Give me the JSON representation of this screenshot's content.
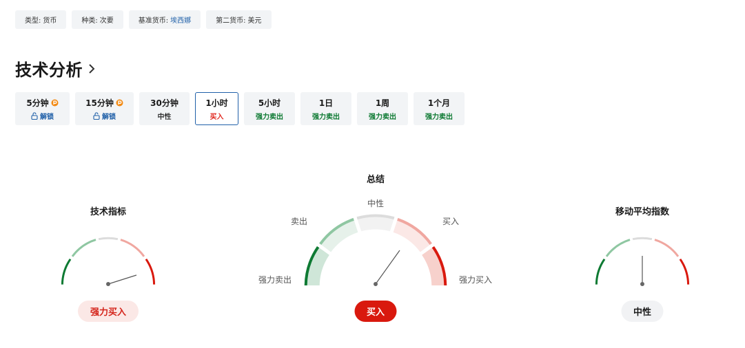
{
  "tags": [
    {
      "label": "类型:",
      "value": "货币",
      "link": false
    },
    {
      "label": "种类:",
      "value": "次要",
      "link": false
    },
    {
      "label": "基准货币:",
      "value": "埃西娜",
      "link": true
    },
    {
      "label": "第二货币:",
      "value": "美元",
      "link": false
    }
  ],
  "title": "技术分析",
  "periods": [
    {
      "label": "5分钟",
      "status": "解锁",
      "pro": true,
      "locked": true,
      "tone": "blue"
    },
    {
      "label": "15分钟",
      "status": "解锁",
      "pro": true,
      "locked": true,
      "tone": "blue"
    },
    {
      "label": "30分钟",
      "status": "中性",
      "tone": "gray"
    },
    {
      "label": "1小时",
      "status": "买入",
      "tone": "red",
      "active": true
    },
    {
      "label": "5小时",
      "status": "强力卖出",
      "tone": "green"
    },
    {
      "label": "1日",
      "status": "强力卖出",
      "tone": "green"
    },
    {
      "label": "1周",
      "status": "强力卖出",
      "tone": "green"
    },
    {
      "label": "1个月",
      "status": "强力卖出",
      "tone": "green"
    }
  ],
  "summary": {
    "title": "总结",
    "labels": {
      "strong_sell": "强力卖出",
      "sell": "卖出",
      "neutral": "中性",
      "buy": "买入",
      "strong_buy": "强力买入"
    },
    "result": "买入"
  },
  "indicators": {
    "title": "技术指标",
    "result": "强力买入"
  },
  "moving_averages": {
    "title": "移动平均指数",
    "result": "中性"
  },
  "colors": {
    "strong_sell": "#0e7a33",
    "sell": "#8fc7a2",
    "neutral": "#dcdcdc",
    "buy": "#f0a7a0",
    "strong_buy": "#d9190e",
    "link": "#1f5fa8",
    "pro_badge": "#f28a14"
  }
}
